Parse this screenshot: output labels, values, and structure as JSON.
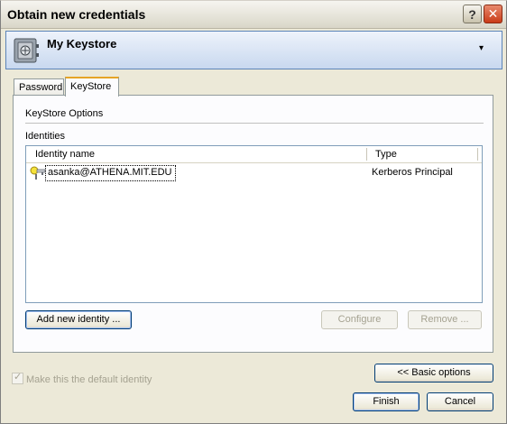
{
  "window": {
    "title": "Obtain new credentials",
    "help_label": "?",
    "close_label": "✕"
  },
  "identity_selector": {
    "selected": "My Keystore",
    "dropdown_glyph": "▾"
  },
  "tabs": [
    {
      "label": "Password",
      "active": false
    },
    {
      "label": "KeyStore",
      "active": true
    }
  ],
  "keystore": {
    "group_label": "KeyStore Options",
    "identities_label": "Identities",
    "columns": [
      "Identity name",
      "Type"
    ],
    "rows": [
      {
        "name": "asanka@ATHENA.MIT.EDU",
        "type": "Kerberos Principal",
        "icon": "key-icon"
      }
    ],
    "buttons": {
      "add": "Add new identity ...",
      "configure": "Configure",
      "remove": "Remove ..."
    }
  },
  "default_checkbox": {
    "label": "Make this the default identity",
    "checked": true,
    "enabled": false
  },
  "footer": {
    "basic_options": "<< Basic options",
    "finish": "Finish",
    "cancel": "Cancel"
  },
  "colors": {
    "accent_tab": "#e6a426",
    "banner": "#c8d8ef",
    "close_button": "#c93b18"
  }
}
